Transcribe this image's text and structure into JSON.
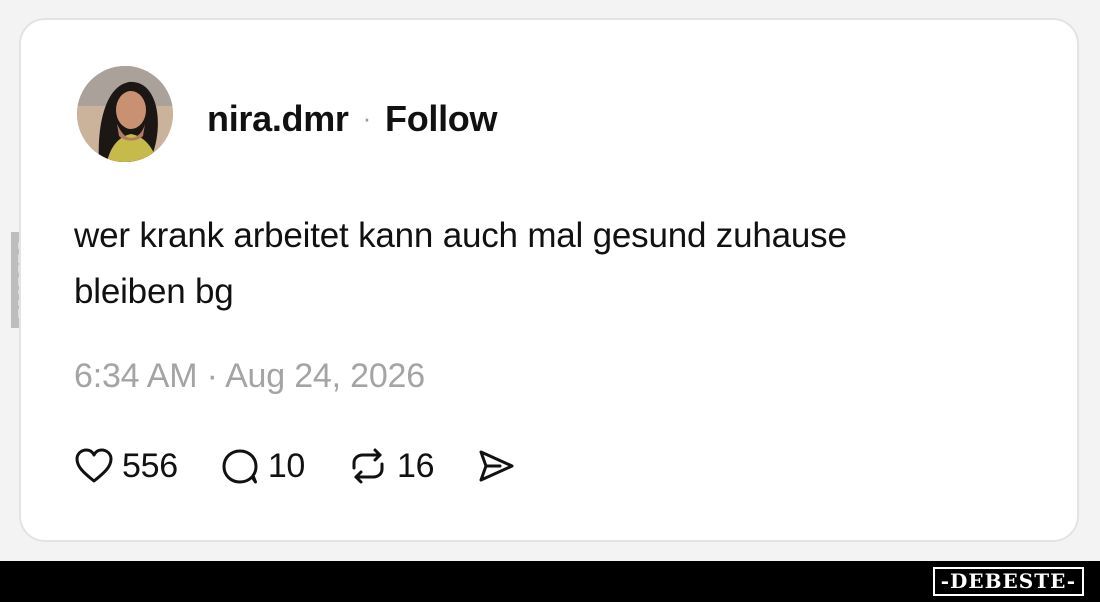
{
  "post": {
    "username": "nira.dmr",
    "separator": "·",
    "follow_label": "Follow",
    "text_line1": "wer krank arbeitet kann auch mal gesund zuhause",
    "text_line2": "bleiben bg",
    "timestamp": "6:34 AM · Aug 24, 2026",
    "avatar_icon": "profile-photo"
  },
  "actions": {
    "likes": "556",
    "comments": "10",
    "reposts": "16",
    "icons": [
      "heart-icon",
      "comment-icon",
      "repost-icon",
      "share-icon"
    ]
  },
  "watermark": {
    "side_text": "DEBESTE",
    "brand_text": "-DEBESTE-"
  },
  "colors": {
    "background": "#f3f3f3",
    "card": "#ffffff",
    "text": "#111111",
    "muted": "#a4a4a4",
    "bar": "#000000"
  }
}
